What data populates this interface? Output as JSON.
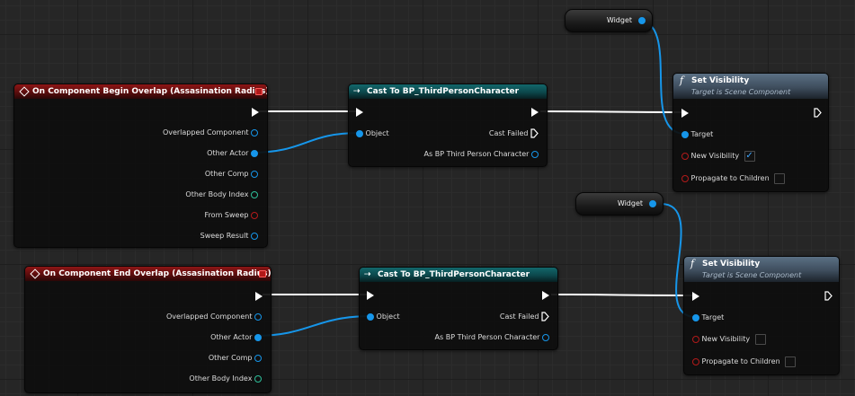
{
  "colors": {
    "event_header": "#8e1616",
    "cast_header": "#12676b",
    "function_header": "#5b7084",
    "object_pin": "#1696ea",
    "struct_pin": "#2ebf9a",
    "bool_pin": "#b31a1a",
    "wire_object": "#1696ea",
    "wire_exec": "#ffffff",
    "check": "#3ea6ff"
  },
  "icons": {
    "event": "event-diamond-icon",
    "close": "close-square-icon",
    "cast": "cast-arrows-icon",
    "function": "function-f-icon",
    "exec": "exec-pin-icon",
    "object": "object-pin-icon",
    "checkmark": "checkmark-icon"
  },
  "begin_overlap": {
    "title": "On Component Begin Overlap (Assasination Radius)",
    "pins": {
      "overlapped_component": "Overlapped Component",
      "other_actor": "Other Actor",
      "other_comp": "Other Comp",
      "other_body_index": "Other Body Index",
      "from_sweep": "From Sweep",
      "sweep_result": "Sweep Result"
    }
  },
  "end_overlap": {
    "title": "On Component End Overlap (Assasination Radius)",
    "pins": {
      "overlapped_component": "Overlapped Component",
      "other_actor": "Other Actor",
      "other_comp": "Other Comp",
      "other_body_index": "Other Body Index"
    }
  },
  "cast_1": {
    "title": "Cast To BP_ThirdPersonCharacter",
    "object": "Object",
    "cast_failed": "Cast Failed",
    "as_output": "As BP Third Person Character"
  },
  "cast_2": {
    "title": "Cast To BP_ThirdPersonCharacter",
    "object": "Object",
    "cast_failed": "Cast Failed",
    "as_output": "As BP Third Person Character"
  },
  "widget_1": {
    "label": "Widget"
  },
  "widget_2": {
    "label": "Widget"
  },
  "set_visibility_1": {
    "title": "Set Visibility",
    "subtitle": "Target is Scene Component",
    "target": "Target",
    "new_visibility": "New Visibility",
    "new_visibility_checked": true,
    "propagate": "Propagate to Children",
    "propagate_checked": false
  },
  "set_visibility_2": {
    "title": "Set Visibility",
    "subtitle": "Target is Scene Component",
    "target": "Target",
    "new_visibility": "New Visibility",
    "new_visibility_checked": false,
    "propagate": "Propagate to Children",
    "propagate_checked": false
  }
}
